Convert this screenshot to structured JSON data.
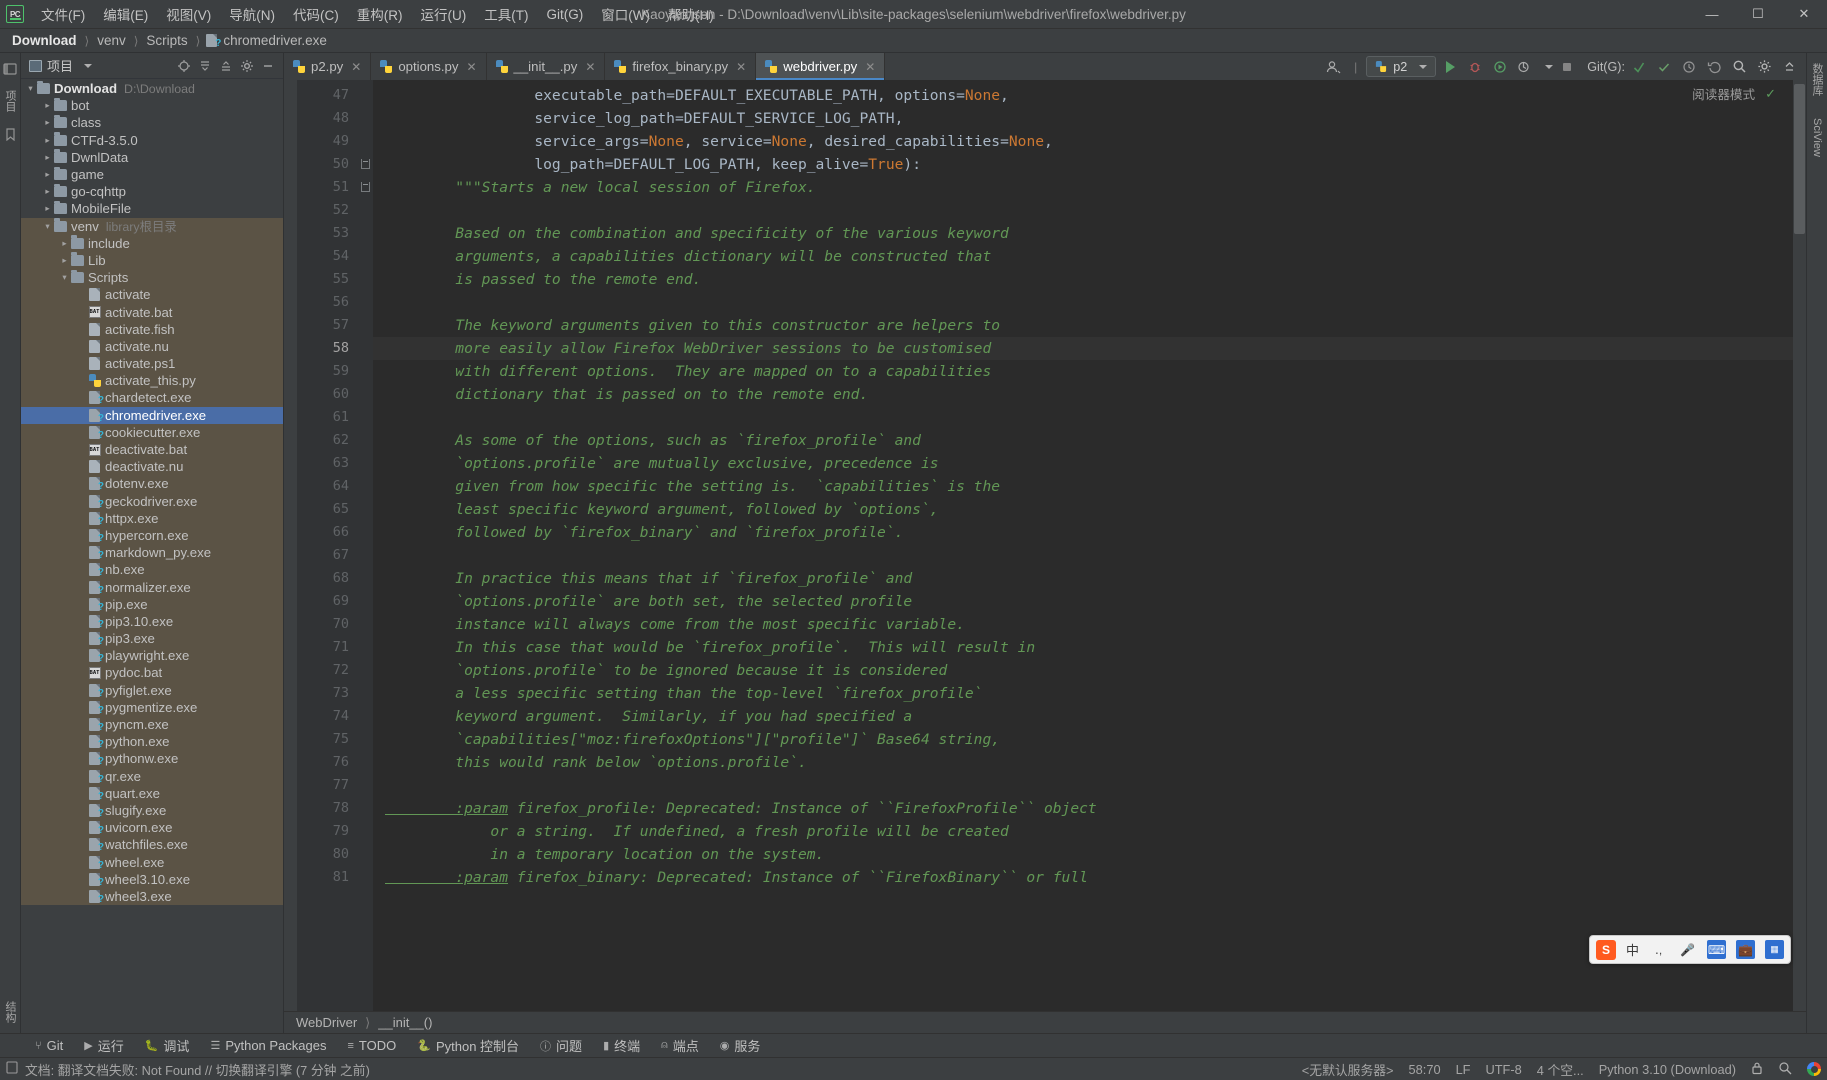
{
  "window": {
    "title": "Kaoyan.json - D:\\Download\\venv\\Lib\\site-packages\\selenium\\webdriver\\firefox\\webdriver.py",
    "minimize": "—",
    "maximize": "☐",
    "close": "✕"
  },
  "menu": {
    "items": [
      {
        "label": "文件(F)",
        "name": "menu-file"
      },
      {
        "label": "编辑(E)",
        "name": "menu-edit"
      },
      {
        "label": "视图(V)",
        "name": "menu-view"
      },
      {
        "label": "导航(N)",
        "name": "menu-navigate"
      },
      {
        "label": "代码(C)",
        "name": "menu-code"
      },
      {
        "label": "重构(R)",
        "name": "menu-refactor"
      },
      {
        "label": "运行(U)",
        "name": "menu-run"
      },
      {
        "label": "工具(T)",
        "name": "menu-tools"
      },
      {
        "label": "Git(G)",
        "name": "menu-git"
      },
      {
        "label": "窗口(W)",
        "name": "menu-window"
      },
      {
        "label": "帮助(H)",
        "name": "menu-help"
      }
    ]
  },
  "breadcrumb": {
    "items": [
      "Download",
      "venv",
      "Scripts",
      "chromedriver.exe"
    ],
    "separator": "〉"
  },
  "run_toolbar": {
    "config_name": "p2",
    "git_label": "Git(G):",
    "profile_icon": "user-settings-icon"
  },
  "project_panel": {
    "title": "项目",
    "tools": [
      "locate-icon",
      "collapse-all-icon",
      "expand-icon",
      "settings-icon",
      "hide-icon"
    ],
    "tree": [
      {
        "depth": 0,
        "label": "Download",
        "sub": "D:\\Download",
        "type": "folder",
        "state": "open",
        "bold": true
      },
      {
        "depth": 1,
        "label": "bot",
        "type": "folder",
        "state": "closed"
      },
      {
        "depth": 1,
        "label": "class",
        "type": "folder",
        "state": "closed"
      },
      {
        "depth": 1,
        "label": "CTFd-3.5.0",
        "type": "folder",
        "state": "closed"
      },
      {
        "depth": 1,
        "label": "DwnlData",
        "type": "folder",
        "state": "closed"
      },
      {
        "depth": 1,
        "label": "game",
        "type": "folder",
        "state": "closed"
      },
      {
        "depth": 1,
        "label": "go-cqhttp",
        "type": "folder",
        "state": "closed"
      },
      {
        "depth": 1,
        "label": "MobileFile",
        "type": "folder",
        "state": "closed"
      },
      {
        "depth": 1,
        "label": "venv",
        "sub": "library根目录",
        "type": "folder",
        "state": "open",
        "scope": true
      },
      {
        "depth": 2,
        "label": "include",
        "type": "folder",
        "state": "closed",
        "scope": true
      },
      {
        "depth": 2,
        "label": "Lib",
        "type": "folder",
        "state": "closed",
        "scope": true
      },
      {
        "depth": 2,
        "label": "Scripts",
        "type": "folder",
        "state": "open",
        "scope": true
      },
      {
        "depth": 3,
        "label": "activate",
        "type": "doc",
        "scope": true
      },
      {
        "depth": 3,
        "label": "activate.bat",
        "type": "bat",
        "scope": true
      },
      {
        "depth": 3,
        "label": "activate.fish",
        "type": "doc",
        "scope": true
      },
      {
        "depth": 3,
        "label": "activate.nu",
        "type": "doc",
        "scope": true
      },
      {
        "depth": 3,
        "label": "activate.ps1",
        "type": "doc",
        "scope": true
      },
      {
        "depth": 3,
        "label": "activate_this.py",
        "type": "py",
        "scope": true
      },
      {
        "depth": 3,
        "label": "chardetect.exe",
        "type": "exe",
        "scope": true
      },
      {
        "depth": 3,
        "label": "chromedriver.exe",
        "type": "exe",
        "selected": true
      },
      {
        "depth": 3,
        "label": "cookiecutter.exe",
        "type": "exe",
        "scope": true
      },
      {
        "depth": 3,
        "label": "deactivate.bat",
        "type": "bat",
        "scope": true
      },
      {
        "depth": 3,
        "label": "deactivate.nu",
        "type": "doc",
        "scope": true
      },
      {
        "depth": 3,
        "label": "dotenv.exe",
        "type": "exe",
        "scope": true
      },
      {
        "depth": 3,
        "label": "geckodriver.exe",
        "type": "exe",
        "scope": true
      },
      {
        "depth": 3,
        "label": "httpx.exe",
        "type": "exe",
        "scope": true
      },
      {
        "depth": 3,
        "label": "hypercorn.exe",
        "type": "exe",
        "scope": true
      },
      {
        "depth": 3,
        "label": "markdown_py.exe",
        "type": "exe",
        "scope": true
      },
      {
        "depth": 3,
        "label": "nb.exe",
        "type": "exe",
        "scope": true
      },
      {
        "depth": 3,
        "label": "normalizer.exe",
        "type": "exe",
        "scope": true
      },
      {
        "depth": 3,
        "label": "pip.exe",
        "type": "exe",
        "scope": true
      },
      {
        "depth": 3,
        "label": "pip3.10.exe",
        "type": "exe",
        "scope": true
      },
      {
        "depth": 3,
        "label": "pip3.exe",
        "type": "exe",
        "scope": true
      },
      {
        "depth": 3,
        "label": "playwright.exe",
        "type": "exe",
        "scope": true
      },
      {
        "depth": 3,
        "label": "pydoc.bat",
        "type": "bat",
        "scope": true
      },
      {
        "depth": 3,
        "label": "pyfiglet.exe",
        "type": "exe",
        "scope": true
      },
      {
        "depth": 3,
        "label": "pygmentize.exe",
        "type": "exe",
        "scope": true
      },
      {
        "depth": 3,
        "label": "pyncm.exe",
        "type": "exe",
        "scope": true
      },
      {
        "depth": 3,
        "label": "python.exe",
        "type": "exe",
        "scope": true
      },
      {
        "depth": 3,
        "label": "pythonw.exe",
        "type": "exe",
        "scope": true
      },
      {
        "depth": 3,
        "label": "qr.exe",
        "type": "exe",
        "scope": true
      },
      {
        "depth": 3,
        "label": "quart.exe",
        "type": "exe",
        "scope": true
      },
      {
        "depth": 3,
        "label": "slugify.exe",
        "type": "exe",
        "scope": true
      },
      {
        "depth": 3,
        "label": "uvicorn.exe",
        "type": "exe",
        "scope": true
      },
      {
        "depth": 3,
        "label": "watchfiles.exe",
        "type": "exe",
        "scope": true
      },
      {
        "depth": 3,
        "label": "wheel.exe",
        "type": "exe",
        "scope": true
      },
      {
        "depth": 3,
        "label": "wheel3.10.exe",
        "type": "exe",
        "scope": true
      },
      {
        "depth": 3,
        "label": "wheel3.exe",
        "type": "exe",
        "scope": true
      }
    ]
  },
  "left_rail": {
    "top_label": "项目",
    "bottom_label": "结构",
    "icons": [
      "project-icon",
      "bookmarks-icon",
      "structure-icon"
    ]
  },
  "right_rail": {
    "labels": [
      "数据库",
      "SciView"
    ]
  },
  "editor": {
    "tabs": [
      {
        "label": "p2.py",
        "active": false
      },
      {
        "label": "options.py",
        "active": false
      },
      {
        "label": "__init__.py",
        "active": false
      },
      {
        "label": "firefox_binary.py",
        "active": false
      },
      {
        "label": "webdriver.py",
        "active": true
      }
    ],
    "reader_mode": "阅读器模式",
    "first_line": 47,
    "current_line": 58,
    "breadcrumb": [
      "WebDriver",
      "__init__()"
    ],
    "lines": [
      {
        "n": 47,
        "fold": false,
        "tokens": [
          {
            "t": "                 executable_path=DEFAULT_EXECUTABLE_PATH, options=",
            "c": "p"
          },
          {
            "t": "None",
            "c": "k"
          },
          {
            "t": ",",
            "c": "p"
          }
        ]
      },
      {
        "n": 48,
        "fold": false,
        "tokens": [
          {
            "t": "                 service_log_path=DEFAULT_SERVICE_LOG_PATH,",
            "c": "p"
          }
        ]
      },
      {
        "n": 49,
        "fold": false,
        "tokens": [
          {
            "t": "                 service_args=",
            "c": "p"
          },
          {
            "t": "None",
            "c": "k"
          },
          {
            "t": ", service=",
            "c": "p"
          },
          {
            "t": "None",
            "c": "k"
          },
          {
            "t": ", desired_capabilities=",
            "c": "p"
          },
          {
            "t": "None",
            "c": "k"
          },
          {
            "t": ",",
            "c": "p"
          }
        ]
      },
      {
        "n": 50,
        "fold": true,
        "tokens": [
          {
            "t": "                 log_path=DEFAULT_LOG_PATH, keep_alive=",
            "c": "p"
          },
          {
            "t": "True",
            "c": "k"
          },
          {
            "t": "):",
            "c": "p"
          }
        ]
      },
      {
        "n": 51,
        "fold": true,
        "tokens": [
          {
            "t": "        \"\"\"Starts a new local session of Firefox.",
            "c": "d"
          }
        ]
      },
      {
        "n": 52,
        "fold": false,
        "tokens": [
          {
            "t": "",
            "c": "d"
          }
        ]
      },
      {
        "n": 53,
        "fold": false,
        "tokens": [
          {
            "t": "        Based on the combination and specificity of the various keyword",
            "c": "d"
          }
        ]
      },
      {
        "n": 54,
        "fold": false,
        "tokens": [
          {
            "t": "        arguments, a capabilities dictionary will be constructed that",
            "c": "d"
          }
        ]
      },
      {
        "n": 55,
        "fold": false,
        "tokens": [
          {
            "t": "        is passed to the remote end.",
            "c": "d"
          }
        ]
      },
      {
        "n": 56,
        "fold": false,
        "tokens": [
          {
            "t": "",
            "c": "d"
          }
        ]
      },
      {
        "n": 57,
        "fold": false,
        "tokens": [
          {
            "t": "        The keyword arguments given to this constructor are helpers to",
            "c": "d"
          }
        ]
      },
      {
        "n": 58,
        "fold": false,
        "current": true,
        "tokens": [
          {
            "t": "        more easily allow Firefox WebDriver sessions to be customised",
            "c": "d"
          }
        ]
      },
      {
        "n": 59,
        "fold": false,
        "tokens": [
          {
            "t": "        with different options.  They are mapped on to a capabilities",
            "c": "d"
          }
        ]
      },
      {
        "n": 60,
        "fold": false,
        "tokens": [
          {
            "t": "        dictionary that is passed on to the remote end.",
            "c": "d"
          }
        ]
      },
      {
        "n": 61,
        "fold": false,
        "tokens": [
          {
            "t": "",
            "c": "d"
          }
        ]
      },
      {
        "n": 62,
        "fold": false,
        "tokens": [
          {
            "t": "        As some of the options, such as `firefox_profile` and",
            "c": "d"
          }
        ]
      },
      {
        "n": 63,
        "fold": false,
        "tokens": [
          {
            "t": "        `options.profile` are mutually exclusive, precedence is",
            "c": "d"
          }
        ]
      },
      {
        "n": 64,
        "fold": false,
        "tokens": [
          {
            "t": "        given from how specific the setting is.  `capabilities` is the",
            "c": "d"
          }
        ]
      },
      {
        "n": 65,
        "fold": false,
        "tokens": [
          {
            "t": "        least specific keyword argument, followed by `options`,",
            "c": "d"
          }
        ]
      },
      {
        "n": 66,
        "fold": false,
        "tokens": [
          {
            "t": "        followed by `firefox_binary` and `firefox_profile`.",
            "c": "d"
          }
        ]
      },
      {
        "n": 67,
        "fold": false,
        "tokens": [
          {
            "t": "",
            "c": "d"
          }
        ]
      },
      {
        "n": 68,
        "fold": false,
        "tokens": [
          {
            "t": "        In practice this means that if `firefox_profile` and",
            "c": "d"
          }
        ]
      },
      {
        "n": 69,
        "fold": false,
        "tokens": [
          {
            "t": "        `options.profile` are both set, the selected profile",
            "c": "d"
          }
        ]
      },
      {
        "n": 70,
        "fold": false,
        "tokens": [
          {
            "t": "        instance will always come from the most specific variable.",
            "c": "d"
          }
        ]
      },
      {
        "n": 71,
        "fold": false,
        "tokens": [
          {
            "t": "        In this case that would be `firefox_profile`.  This will result in",
            "c": "d"
          }
        ]
      },
      {
        "n": 72,
        "fold": false,
        "tokens": [
          {
            "t": "        `options.profile` to be ignored because it is considered",
            "c": "d"
          }
        ]
      },
      {
        "n": 73,
        "fold": false,
        "tokens": [
          {
            "t": "        a less specific setting than the top-level `firefox_profile`",
            "c": "d"
          }
        ]
      },
      {
        "n": 74,
        "fold": false,
        "tokens": [
          {
            "t": "        keyword argument.  Similarly, if you had specified a",
            "c": "d"
          }
        ]
      },
      {
        "n": 75,
        "fold": false,
        "tokens": [
          {
            "t": "        `capabilities[\"moz:firefoxOptions\"][\"profile\"]` Base64 string,",
            "c": "d"
          }
        ]
      },
      {
        "n": 76,
        "fold": false,
        "tokens": [
          {
            "t": "        this would rank below `options.profile`.",
            "c": "d"
          }
        ]
      },
      {
        "n": 77,
        "fold": false,
        "tokens": [
          {
            "t": "",
            "c": "d"
          }
        ]
      },
      {
        "n": 78,
        "fold": false,
        "tokens": [
          {
            "t": "        :param",
            "c": "dp"
          },
          {
            "t": " firefox_profile: Deprecated: Instance of ``FirefoxProfile`` object",
            "c": "d"
          }
        ]
      },
      {
        "n": 79,
        "fold": false,
        "tokens": [
          {
            "t": "            or a string.  If undefined, a fresh profile will be created",
            "c": "d"
          }
        ]
      },
      {
        "n": 80,
        "fold": false,
        "tokens": [
          {
            "t": "            in a temporary location on the system.",
            "c": "d"
          }
        ]
      },
      {
        "n": 81,
        "fold": false,
        "tokens": [
          {
            "t": "        :param",
            "c": "dp"
          },
          {
            "t": " firefox_binary: Deprecated: Instance of ``FirefoxBinary`` or full",
            "c": "d"
          }
        ]
      }
    ]
  },
  "bottom_toolwindows": [
    {
      "label": "Git",
      "icon": "git-branch-icon"
    },
    {
      "label": "运行",
      "icon": "run-icon"
    },
    {
      "label": "调试",
      "icon": "debug-icon"
    },
    {
      "label": "Python Packages",
      "icon": "packages-icon"
    },
    {
      "label": "TODO",
      "icon": "todo-icon"
    },
    {
      "label": "Python 控制台",
      "icon": "console-icon"
    },
    {
      "label": "问题",
      "icon": "problems-icon"
    },
    {
      "label": "终端",
      "icon": "terminal-icon"
    },
    {
      "label": "端点",
      "icon": "endpoints-icon"
    },
    {
      "label": "服务",
      "icon": "services-icon"
    }
  ],
  "statusbar": {
    "message": "文档: 翻译文档失败: Not Found // 切换翻译引擎 (7 分钟 之前)",
    "server": "<无默认服务器>",
    "position": "58:70",
    "line_sep": "LF",
    "encoding": "UTF-8",
    "indent": "4 个空...",
    "interpreter": "Python 3.10 (Download)",
    "icons": [
      "lock-icon",
      "inspections-icon",
      "google-icon"
    ]
  },
  "ime_widget": {
    "logo": "S",
    "mode": "中",
    "icons": [
      "comma-icon",
      "mic-icon",
      "keyboard-icon",
      "toolbox-icon",
      "apps-icon"
    ]
  }
}
